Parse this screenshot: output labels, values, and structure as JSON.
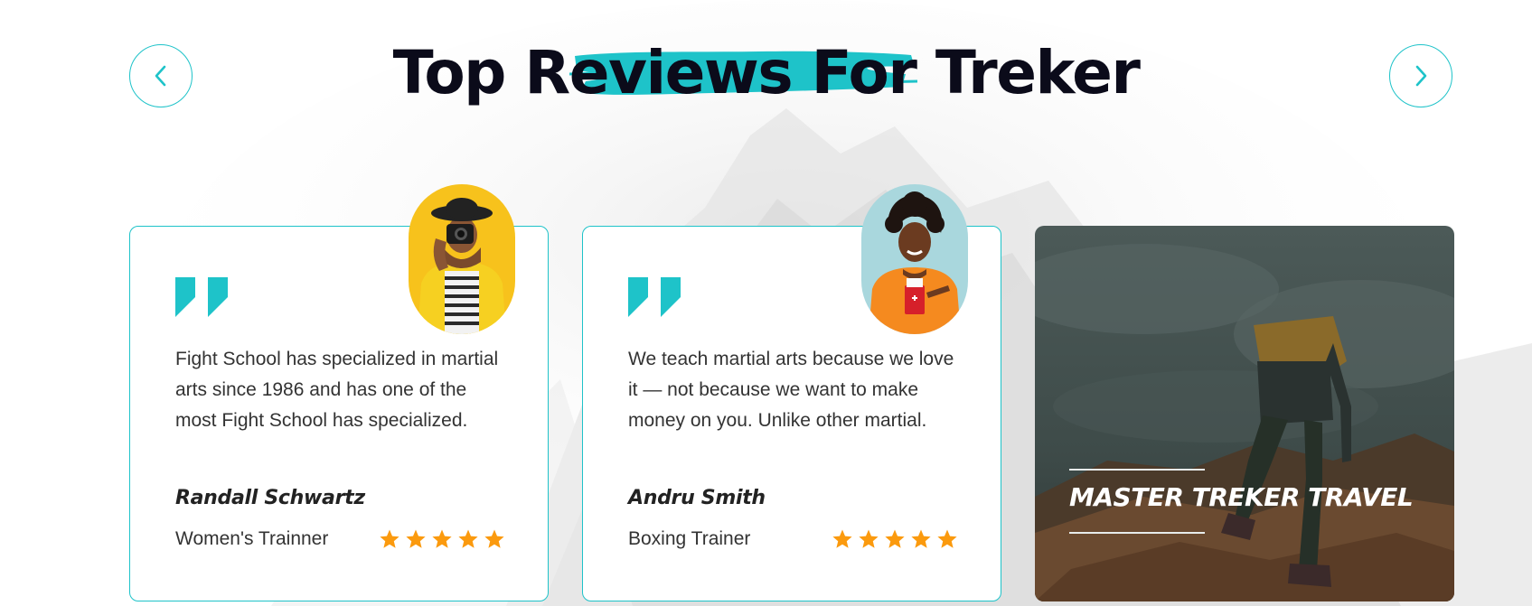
{
  "section": {
    "title": "Top Reviews For Treker"
  },
  "nav": {
    "prev_icon": "chevron-left-icon",
    "next_icon": "chevron-right-icon"
  },
  "colors": {
    "accent": "#1ec3c9",
    "star": "#fb9a0e",
    "heading": "#0b0b1a"
  },
  "reviews": [
    {
      "text": "Fight School has specialized in martial arts since 1986 and has one of the most Fight School has specialized.",
      "name": "Randall Schwartz",
      "role": "Women's Trainner",
      "rating": 5
    },
    {
      "text": "We teach martial arts because we love it — not because we want to make money on you. Unlike other martial.",
      "name": "Andru Smith",
      "role": "Boxing Trainer",
      "rating": 5
    }
  ],
  "promo": {
    "title": "MASTER TREKER TRAVEL"
  }
}
